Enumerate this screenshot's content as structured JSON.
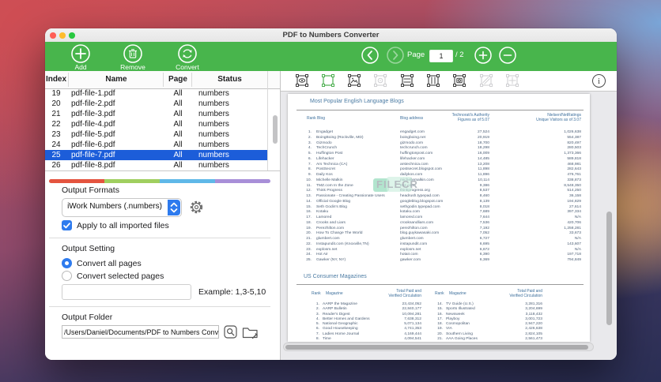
{
  "window": {
    "title": "PDF to Numbers Converter"
  },
  "toolbar": {
    "add_label": "Add",
    "remove_label": "Remove",
    "convert_label": "Convert",
    "page_label": "Page",
    "page_value": "1",
    "page_total": "/ 2",
    "icons": [
      "add-icon",
      "remove-trash-icon",
      "convert-refresh-icon",
      "back-icon",
      "forward-icon",
      "zoom-in-icon",
      "zoom-out-icon"
    ],
    "colors": {
      "toolbar_green": "#48b54c"
    }
  },
  "file_table": {
    "headers": {
      "index": "Index",
      "name": "Name",
      "page": "Page",
      "status": "Status"
    },
    "selected_index": "25",
    "selection_color": "#1c5dd9",
    "rows": [
      {
        "index": "19",
        "name": "pdf-file-1.pdf",
        "page": "All",
        "status": "numbers"
      },
      {
        "index": "20",
        "name": "pdf-file-2.pdf",
        "page": "All",
        "status": "numbers"
      },
      {
        "index": "21",
        "name": "pdf-file-3.pdf",
        "page": "All",
        "status": "numbers"
      },
      {
        "index": "22",
        "name": "pdf-file-4.pdf",
        "page": "All",
        "status": "numbers"
      },
      {
        "index": "23",
        "name": "pdf-file-5.pdf",
        "page": "All",
        "status": "numbers"
      },
      {
        "index": "24",
        "name": "pdf-file-6.pdf",
        "page": "All",
        "status": "numbers"
      },
      {
        "index": "25",
        "name": "pdf-file-7.pdf",
        "page": "All",
        "status": "numbers"
      },
      {
        "index": "26",
        "name": "pdf-file-8.pdf",
        "page": "All",
        "status": "numbers"
      }
    ]
  },
  "output_formats": {
    "label": "Output Formats",
    "dropdown_value": "iWork Numbers (.numbers)",
    "checkbox_label": "Apply to all imported files",
    "checkbox_checked": true,
    "icons": [
      "dropdown-stepper-icon",
      "gear-icon"
    ],
    "accent_blue": "#2e7bee",
    "rainbow_colors": [
      "#e4543f",
      "#a0cf5f",
      "#5fb8e8",
      "#a88fd8"
    ]
  },
  "output_setting": {
    "label": "Output Setting",
    "radio_all_label": "Convert all pages",
    "radio_selected_label": "Convert selected pages",
    "selected_option": "Convert all pages",
    "range_value": "",
    "example_label": "Example: 1,3-5,10"
  },
  "output_folder": {
    "label": "Output Folder",
    "path": "/Users/Daniel/Documents/PDF to Numbers Converter",
    "icons": [
      "reveal-search-icon",
      "choose-folder-icon"
    ]
  },
  "preview_toolbar": {
    "icons": [
      "preview-eye-icon",
      "selection-frame-icon",
      "image-region-icon",
      "disc-region-icon",
      "table-rows-icon",
      "table-columns-icon",
      "capture-region-icon",
      "hatch-region-icon",
      "grid-region-icon",
      "info-icon"
    ],
    "active_icon": "selection-frame-icon",
    "active_color": "#4CAF50",
    "disabled_icons": [
      "disc-region-icon",
      "hatch-region-icon",
      "grid-region-icon"
    ]
  },
  "preview": {
    "watermark": "FILECR",
    "blogs": {
      "title": "Most Popular English Language Blogs",
      "headers": {
        "rank": "Rank",
        "blog": "Blog",
        "address": "Blog address",
        "authority_line1": "Technorati's Authority",
        "authority_line2": "Figures as of 5.07",
        "visitors_line1": "Nielsen/NetRatings",
        "visitors_line2": "Unique Visitors as of 3.07"
      },
      "rows": [
        {
          "rank": 1,
          "blog": "Engadget",
          "address": "engadget.com",
          "authority": "27,524",
          "visitors": "1,026,638"
        },
        {
          "rank": 2,
          "blog": "BoingBoing (Rockville, MD)",
          "address": "boingboing.net",
          "authority": "20,919",
          "visitors": "554,387"
        },
        {
          "rank": 3,
          "blog": "Gizmodo",
          "address": "gizmodo.com",
          "authority": "18,700",
          "visitors": "820,497"
        },
        {
          "rank": 4,
          "blog": "TechCrunch",
          "address": "techcrunch.com",
          "authority": "18,298",
          "visitors": "280,503"
        },
        {
          "rank": 5,
          "blog": "Huffington Post",
          "address": "huffingtonpost.com",
          "authority": "16,009",
          "visitors": "1,373,366"
        },
        {
          "rank": 6,
          "blog": "Lifehacker",
          "address": "lifehacker.com",
          "authority": "14,485",
          "visitors": "589,818"
        },
        {
          "rank": 7,
          "blog": "Ars Technica (CA)",
          "address": "arstechnica.com",
          "authority": "13,208",
          "visitors": "468,981"
        },
        {
          "rank": 8,
          "blog": "PostSecret",
          "address": "postsecret.blogspot.com",
          "authority": "11,898",
          "visitors": "282,643"
        },
        {
          "rank": 9,
          "blog": "Daily Kos",
          "address": "dailykos.com",
          "authority": "11,896",
          "visitors": "476,761"
        },
        {
          "rank": 10,
          "blog": "Michelle Malkin",
          "address": "michellemalkin.com",
          "authority": "10,114",
          "visitors": "338,873"
        },
        {
          "rank": 11,
          "blog": "TMZ.com In the Zone",
          "address": "tmz.com",
          "authority": "9,386",
          "visitors": "8,548,350"
        },
        {
          "rank": 12,
          "blog": "Think Progress",
          "address": "thinkprogress.org",
          "authority": "8,537",
          "visitors": "514,250"
        },
        {
          "rank": 13,
          "blog": "Passionate - Creating Passionate Users",
          "address": "headrush.typepad.com",
          "authority": "8,460",
          "visitors": "36,158"
        },
        {
          "rank": 14,
          "blog": "Official Google Blog",
          "address": "googleblog.blogspot.com",
          "authority": "8,139",
          "visitors": "194,829"
        },
        {
          "rank": 15,
          "blog": "Seth Godin's Blog",
          "address": "sethgodin.typepad.com",
          "authority": "8,018",
          "visitors": "27,614"
        },
        {
          "rank": 16,
          "blog": "Kotaku",
          "address": "kotaku.com",
          "authority": "7,689",
          "visitors": "397,334"
        },
        {
          "rank": 17,
          "blog": "Lamored",
          "address": "lamored.com",
          "authority": "7,644",
          "visitors": "N/A"
        },
        {
          "rank": 18,
          "blog": "Crooks and Liars",
          "address": "crooksandliars.com",
          "authority": "7,536",
          "visitors": "420,706"
        },
        {
          "rank": 19,
          "blog": "Perezhilton.com",
          "address": "perezhilton.com",
          "authority": "7,192",
          "visitors": "1,258,281"
        },
        {
          "rank": 20,
          "blog": "How To Change The World",
          "address": "blog.guykawasaki.com",
          "authority": "7,052",
          "visitors": "33,673"
        },
        {
          "rank": 21,
          "blog": "glumbert.com",
          "address": "glumbert.com",
          "authority": "6,727",
          "visitors": "N/A"
        },
        {
          "rank": 22,
          "blog": "Instapundit.com (Knoxville,TN)",
          "address": "instapundit.com",
          "authority": "6,695",
          "visitors": "143,607"
        },
        {
          "rank": 23,
          "blog": "explosm.net",
          "address": "explosm.net",
          "authority": "6,672",
          "visitors": "N/A"
        },
        {
          "rank": 24,
          "blog": "Hot Air",
          "address": "hotair.com",
          "authority": "6,390",
          "visitors": "197,718"
        },
        {
          "rank": 25,
          "blog": "Gawker (NY, NY)",
          "address": "gawker.com",
          "authority": "6,369",
          "visitors": "794,849"
        }
      ]
    },
    "magazines": {
      "title": "US Consumer Magazines",
      "headers": {
        "rank": "Rank",
        "magazine": "Magazine",
        "circulation_line1": "Total Paid and",
        "circulation_line2": "Verified Circulation"
      },
      "left_rows": [
        {
          "rank": 1,
          "magazine": "AARP the Magazine",
          "circulation": "23,434,052"
        },
        {
          "rank": 2,
          "magazine": "AARP Bulletin",
          "circulation": "22,840,177"
        },
        {
          "rank": 3,
          "magazine": "Reader's Digest",
          "circulation": "10,094,281"
        },
        {
          "rank": 4,
          "magazine": "Better Homes and Gardens",
          "circulation": "7,638,312"
        },
        {
          "rank": 5,
          "magazine": "National Geographic",
          "circulation": "5,071,134"
        },
        {
          "rank": 6,
          "magazine": "Good Housekeeping",
          "circulation": "4,741,353"
        },
        {
          "rank": 7,
          "magazine": "Ladies Home Journal",
          "circulation": "4,169,444"
        },
        {
          "rank": 8,
          "magazine": "Time",
          "circulation": "4,094,541"
        }
      ],
      "right_rows": [
        {
          "rank": 14,
          "magazine": "TV Guide (U.S.)",
          "circulation": "3,281,316"
        },
        {
          "rank": 15,
          "magazine": "Sports Illustrated",
          "circulation": "3,204,699"
        },
        {
          "rank": 16,
          "magazine": "Newsweek",
          "circulation": "3,118,432"
        },
        {
          "rank": 17,
          "magazine": "Playboy",
          "circulation": "3,001,723"
        },
        {
          "rank": 18,
          "magazine": "Cosmopolitan",
          "circulation": "2,947,220"
        },
        {
          "rank": 19,
          "magazine": "VIA",
          "circulation": "2,426,638"
        },
        {
          "rank": 20,
          "magazine": "Southern Living",
          "circulation": "2,824,105"
        },
        {
          "rank": 21,
          "magazine": "AAA Going Places",
          "circulation": "2,561,473"
        }
      ]
    }
  }
}
